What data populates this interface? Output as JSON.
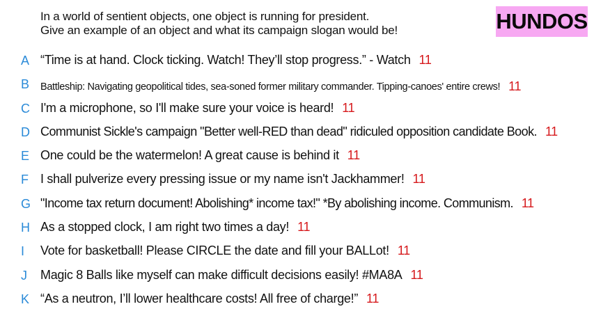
{
  "prompt": {
    "line1": "In a world of sentient objects, one object is running for president.",
    "line2": "Give an example of an object and what its campaign slogan would be!"
  },
  "logo": "HUNDOS",
  "answers": [
    {
      "letter": "A",
      "text": "“Time is at hand. Clock ticking. Watch! They’ll stop progress.” - Watch",
      "score": "11"
    },
    {
      "letter": "B",
      "text": "Battleship: Navigating geopolitical tides, sea-soned former military commander. Tipping-canoes' entire crews!",
      "score": "11"
    },
    {
      "letter": "C",
      "text": "I'm a microphone, so I'll make sure your voice is heard!",
      "score": "11"
    },
    {
      "letter": "D",
      "text": "Communist Sickle's campaign \"Better well-RED than dead\" ridiculed opposition candidate Book.",
      "score": "11"
    },
    {
      "letter": "E",
      "text": "One could be the watermelon! A great cause is behind it",
      "score": "11"
    },
    {
      "letter": "F",
      "text": "I shall pulverize every pressing issue or my name isn't Jackhammer!",
      "score": "11"
    },
    {
      "letter": "G",
      "text": "\"Income tax return document! Abolishing* income tax!\" *By abolishing income. Communism.",
      "score": "11"
    },
    {
      "letter": "H",
      "text": "As a stopped clock, I am right two times a day!",
      "score": "11"
    },
    {
      "letter": "I",
      "text": "Vote for basketball! Please CIRCLE the date and fill your BALLot!",
      "score": "11"
    },
    {
      "letter": "J",
      "text": "Magic 8 Balls like myself can make difficult decisions easily! #MA8A",
      "score": "11"
    },
    {
      "letter": "K",
      "text": "“As a neutron, I’ll lower healthcare costs! All free of charge!”",
      "score": "11"
    }
  ],
  "colors": {
    "letter": "#2a8ad8",
    "score": "#d6191c",
    "logo_bg": "#f7a8f2"
  }
}
